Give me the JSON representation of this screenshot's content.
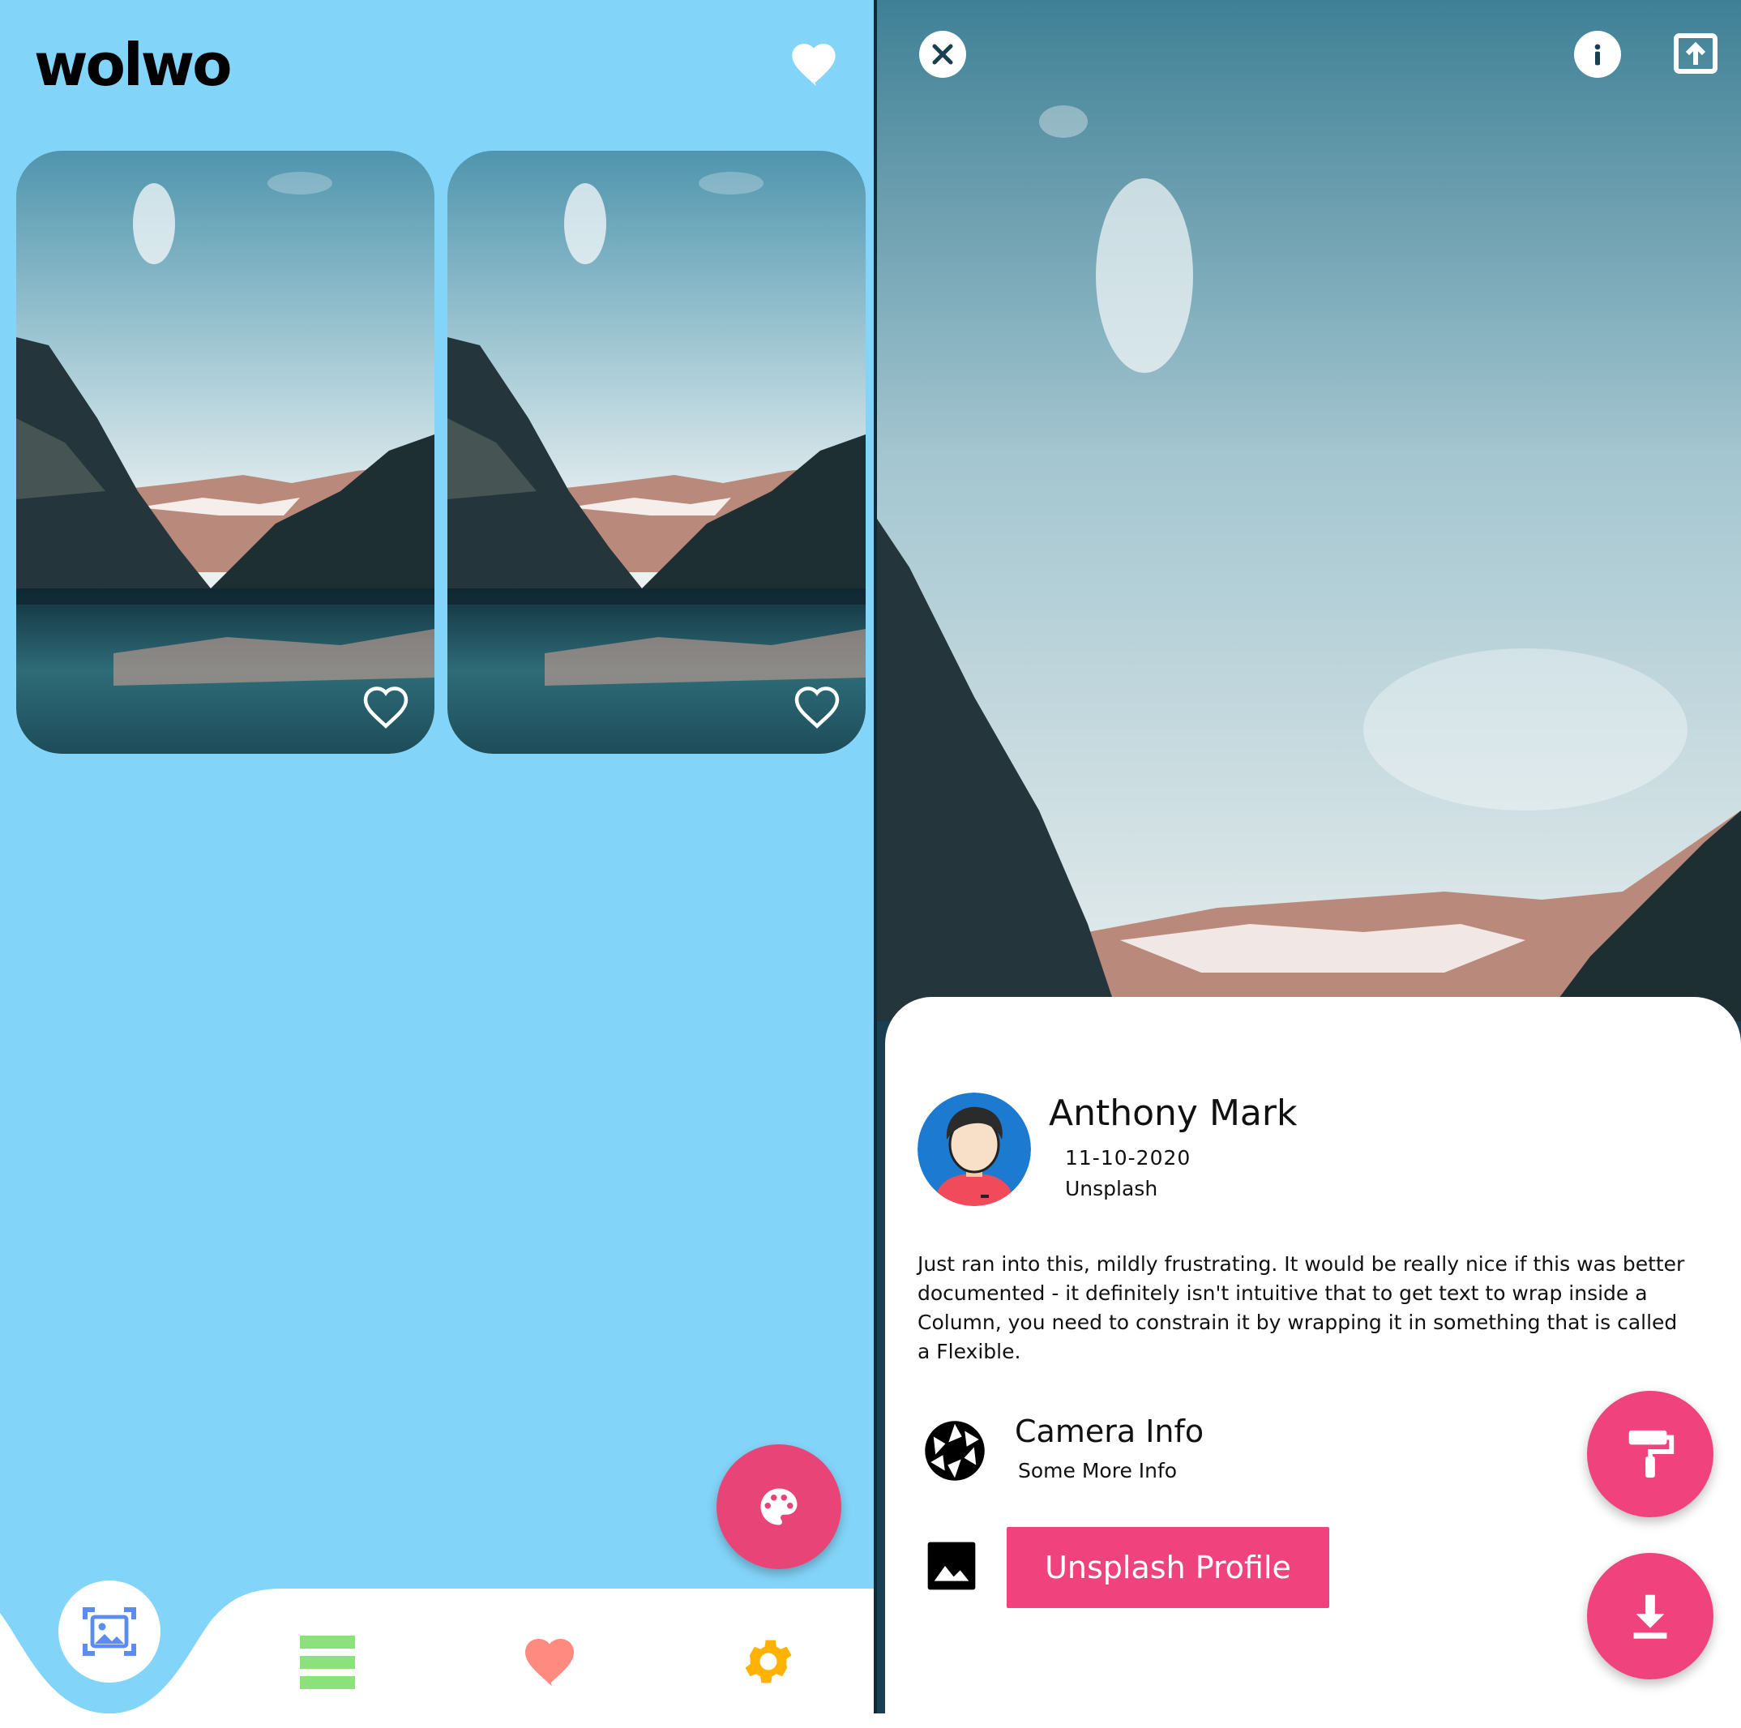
{
  "colors": {
    "left_background": "#83D4F9",
    "accent_pink": "#F0437D",
    "palette_fab": "#E94478",
    "nav_list_green": "#8BE27A",
    "nav_heart_salmon": "#FF8A80",
    "nav_settings_orange": "#FFB300",
    "gallery_icon_blue": "#5B8DEF"
  },
  "left": {
    "app_title": "wolwo",
    "header_icon": "heart-icon",
    "cards": [
      {
        "icon": "heart-outline-icon"
      },
      {
        "icon": "heart-outline-icon"
      }
    ],
    "fab_icon": "palette-icon",
    "bottom_nav": [
      {
        "icon": "gallery-icon",
        "selected": true
      },
      {
        "icon": "list-icon",
        "selected": false
      },
      {
        "icon": "heart-icon",
        "selected": false
      },
      {
        "icon": "settings-icon",
        "selected": false
      }
    ]
  },
  "right": {
    "top_icons": [
      "close-icon",
      "info-icon",
      "share-icon"
    ],
    "author": {
      "name": "Anthony Mark",
      "date": "11-10-2020",
      "source": "Unsplash"
    },
    "description": "Just ran into this, mildly frustrating. It would be really nice if this was better documented - it definitely isn't intuitive that to get text to wrap inside a Column, you need to constrain it by wrapping it in something that is called a Flexible.",
    "camera": {
      "title": "Camera Info",
      "subtitle": "Some More Info"
    },
    "profile_button": "Unsplash Profile",
    "fab_icons": [
      "paint-roller-icon",
      "download-icon"
    ]
  }
}
